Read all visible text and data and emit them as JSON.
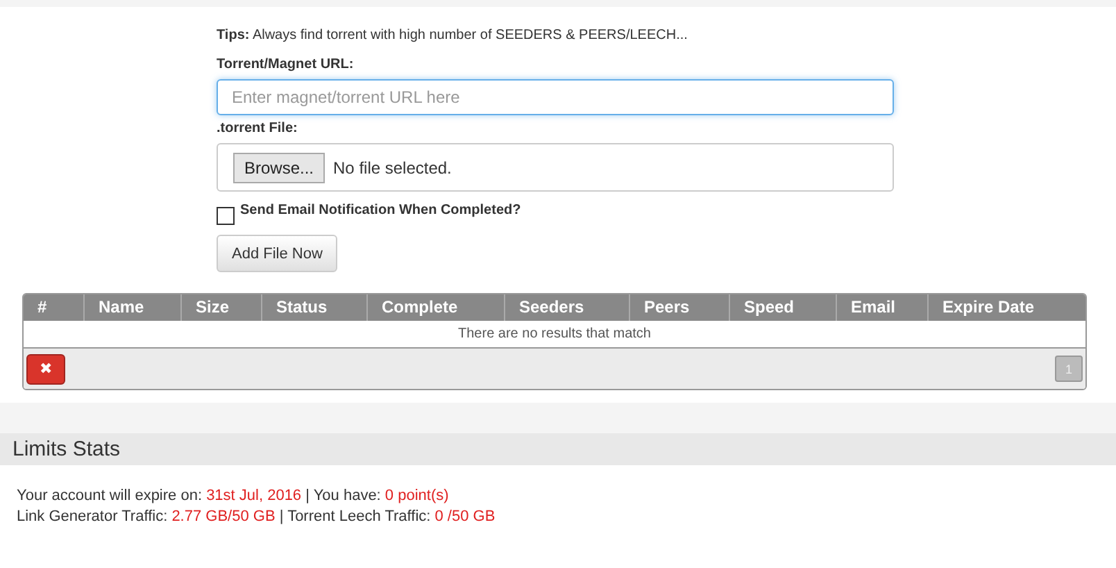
{
  "tips": {
    "label": "Tips:",
    "text": "Always find torrent with high number of SEEDERS & PEERS/LEECH..."
  },
  "url_field": {
    "label": "Torrent/Magnet URL:",
    "placeholder": "Enter magnet/torrent URL here"
  },
  "file_field": {
    "label": ".torrent File:",
    "button": "Browse...",
    "status": "No file selected."
  },
  "email_notify": {
    "label": "Send Email Notification When Completed?",
    "checked": false
  },
  "submit": "Add File Now",
  "table": {
    "columns": [
      "#",
      "Name",
      "Size",
      "Status",
      "Complete",
      "Seeders",
      "Peers",
      "Speed",
      "Email",
      "Expire Date"
    ],
    "empty": "There are no results that match",
    "delete_button": "✖",
    "pages": [
      {
        "label": "1",
        "selected": true
      }
    ]
  },
  "limits": {
    "title": "Limits Stats",
    "lines": [
      [
        {
          "text": "Your account will expire on: ",
          "kind": "label"
        },
        {
          "text": "31st Jul, 2016",
          "kind": "value"
        },
        {
          "text": " | You have: ",
          "kind": "label"
        },
        {
          "text": "0 point(s)",
          "kind": "value"
        }
      ],
      [
        {
          "text": "Link Generator Traffic: ",
          "kind": "label"
        },
        {
          "text": "2.77 GB/50 GB",
          "kind": "value"
        },
        {
          "text": " | Torrent Leech Traffic: ",
          "kind": "label"
        },
        {
          "text": "0 /50 GB",
          "kind": "value"
        }
      ]
    ]
  }
}
